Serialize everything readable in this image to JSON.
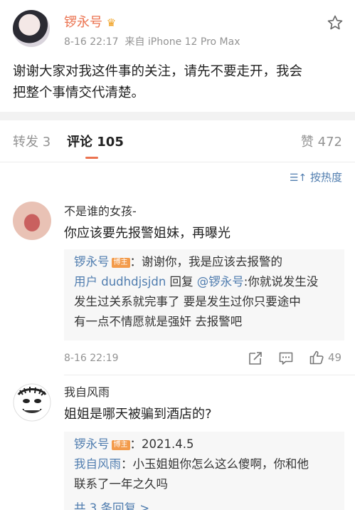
{
  "post": {
    "author": "锣永号",
    "meta": "8-16 22:17  来自 iPhone 12 Pro Max",
    "text_line1": "谢谢大家对我这件事的关注，请先不要走开，我会",
    "text_line2": "把整个事情交代清楚。"
  },
  "tabs": {
    "repost": "转发 3",
    "comments": "评论 105",
    "likes": "赞 472"
  },
  "sort": {
    "label": "按热度"
  },
  "comments": [
    {
      "user": "不是谁的女孩-",
      "text": "你应该要先报警姐妹，再曝光",
      "replies": {
        "r1_user": "锣永号",
        "r1_badge": "博主",
        "r1_text": "：谢谢你，我是应该去报警的",
        "r2_user": "用户 dudhdjsjdn",
        "r2_reply": " 回复 ",
        "r2_target": "@锣永号",
        "r2_text1": ":你就说发生没",
        "r2_line2": "发生过关系就完事了 要是发生过你只要途中",
        "r2_line3": "有一点不情愿就是强奸 去报警吧"
      },
      "time": "8-16 22:19",
      "like_count": "49"
    },
    {
      "user": "我自风雨",
      "text": "姐姐是哪天被骗到酒店的?",
      "replies": {
        "r1_user": "锣永号",
        "r1_badge": "博主",
        "r1_text": "：2021.4.5",
        "r2_user": "我自风雨",
        "r2_text1": "：小玉姐姐你怎么这么傻啊，你和他",
        "r2_line2": "联系了一年之久吗",
        "more": "共 3 条回复 >"
      }
    }
  ],
  "colors": {
    "accent": "#eb7350",
    "link": "#507daf",
    "secondary": "#939393",
    "divider_band": "#f2f2f2",
    "reply_bg": "#f7f7f7"
  }
}
